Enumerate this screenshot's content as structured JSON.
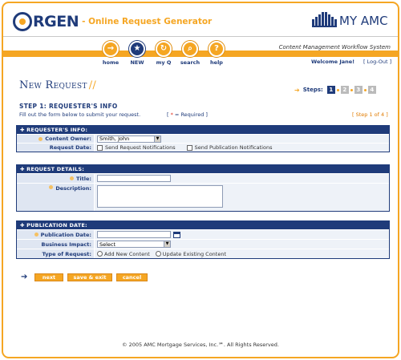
{
  "header": {
    "logo_text": "RGEN",
    "app_subtitle": "- Online Request Generator",
    "brand": "MY AMC",
    "system_label": "Content Management Workflow System",
    "welcome": "Welcome Jane!",
    "logout": "[ Log-Out ]"
  },
  "nav": {
    "items": [
      {
        "label": "home",
        "icon": "→"
      },
      {
        "label": "NEW",
        "icon": "★"
      },
      {
        "label": "my Q",
        "icon": "↻"
      },
      {
        "label": "search",
        "icon": "⌕"
      },
      {
        "label": "help",
        "icon": "?"
      }
    ]
  },
  "page": {
    "title": "New Request",
    "title_suffix": "//",
    "steps_label": "Steps:",
    "steps": [
      "1",
      "2",
      "3",
      "4"
    ],
    "current_step": 1,
    "step_title": "STEP 1: REQUESTER'S INFO",
    "step_desc": "Fill out the form below to submit your request.",
    "required_note_pre": "[ ",
    "required_note_ast": "*",
    "required_note_post": " = Required ]",
    "step_of": "[ Step 1 of 4 ]"
  },
  "requester": {
    "header": "✚ REQUESTER'S INFO:",
    "content_owner_label": "Content Owner:",
    "content_owner_value": "Smith, John",
    "request_date_label": "Request Date:",
    "send_request_label": "Send Request Notifications",
    "send_publication_label": "Send Publication Notifications"
  },
  "details": {
    "header": "✚ REQUEST DETAILS:",
    "title_label": "Title:",
    "title_value": "",
    "description_label": "Description:",
    "description_value": ""
  },
  "publication": {
    "header": "✚ PUBLICATION DATE:",
    "pub_date_label": "Publication Date:",
    "pub_date_value": "",
    "impact_label": "Business Impact:",
    "impact_value": "Select",
    "type_label": "Type of Request:",
    "type_add": "Add New Content",
    "type_update": "Update Existing Content"
  },
  "actions": {
    "next": "next",
    "save_exit": "save & exit",
    "cancel": "cancel"
  },
  "footer": "© 2005 AMC Mortgage Services, Inc.℠. All Rights Reserved.",
  "colors": {
    "brand_navy": "#1f3b7a",
    "brand_orange": "#f5a623"
  }
}
